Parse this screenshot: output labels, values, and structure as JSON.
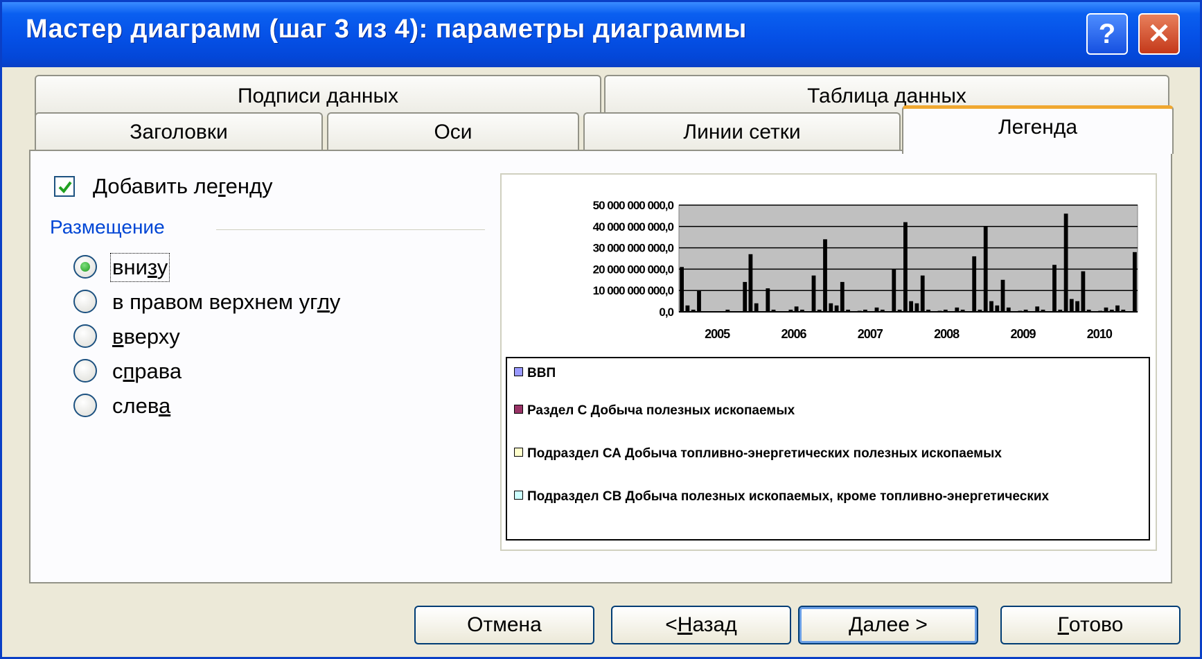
{
  "window": {
    "title": "Мастер диаграмм (шаг 3 из 4): параметры диаграммы",
    "help_glyph": "?",
    "close_glyph": "✕"
  },
  "tabs": [
    {
      "label": "Подписи данных",
      "active": false
    },
    {
      "label": "Таблица данных",
      "active": false
    },
    {
      "label": "Заголовки",
      "active": false
    },
    {
      "label": "Оси",
      "active": false
    },
    {
      "label": "Линии сетки",
      "active": false
    },
    {
      "label": "Легенда",
      "active": true
    }
  ],
  "options": {
    "add_legend_label": "Добавить легенду",
    "add_legend_checked": true,
    "placement_title": "Размещение",
    "placements": [
      {
        "label": "внизу",
        "selected": true
      },
      {
        "label": "в правом верхнем углу",
        "selected": false
      },
      {
        "label": "вверху",
        "selected": false
      },
      {
        "label": "справа",
        "selected": false
      },
      {
        "label": "слева",
        "selected": false
      }
    ]
  },
  "chart_data": {
    "type": "bar",
    "y_tick_labels": [
      "50 000 000 000,0",
      "40 000 000 000,0",
      "30 000 000 000,0",
      "20 000 000 000,0",
      "10 000 000 000,0",
      "0,0"
    ],
    "x_tick_labels": [
      "2005",
      "2006",
      "2007",
      "2008",
      "2009",
      "2010"
    ],
    "ylim": [
      0,
      50000000000
    ],
    "grid": true,
    "plot_background": "#c0c0c0",
    "legend_position": "bottom",
    "values": [
      21,
      3,
      1,
      10,
      0.3,
      0.2,
      0.3,
      0.2,
      1,
      0.3,
      0.2,
      14,
      27,
      4,
      0.3,
      11,
      1,
      0.3,
      0.2,
      1,
      2.5,
      1,
      0.3,
      17,
      1,
      34,
      4,
      3,
      14,
      1,
      0.3,
      0.5,
      1,
      0.3,
      2,
      1,
      0.3,
      20,
      1,
      42,
      5,
      4,
      17,
      1,
      0.3,
      0.5,
      1,
      0.3,
      2,
      1,
      0.3,
      26,
      1,
      40,
      5,
      3,
      15,
      2,
      0.3,
      0.5,
      1,
      0.3,
      2.5,
      1,
      0.3,
      22,
      1,
      46,
      6,
      5,
      19,
      1,
      0.3,
      0.5,
      2,
      1,
      3,
      1,
      0.3,
      28
    ],
    "values_unit": "billions",
    "legend": [
      {
        "name": "ВВП",
        "color": "#9999ff"
      },
      {
        "name": "Раздел С Добыча полезных ископаемых",
        "color": "#993366"
      },
      {
        "name": "Подраздел СА Добыча топливно-энергетических полезных ископаемых",
        "color": "#ffffcc"
      },
      {
        "name": "Подраздел СВ Добыча полезных ископаемых, кроме топливно-энергетических",
        "color": "#ccffff"
      }
    ]
  },
  "buttons": {
    "cancel": "Отмена",
    "back": "< Назад",
    "next": "Далее >",
    "finish": "Готово"
  }
}
